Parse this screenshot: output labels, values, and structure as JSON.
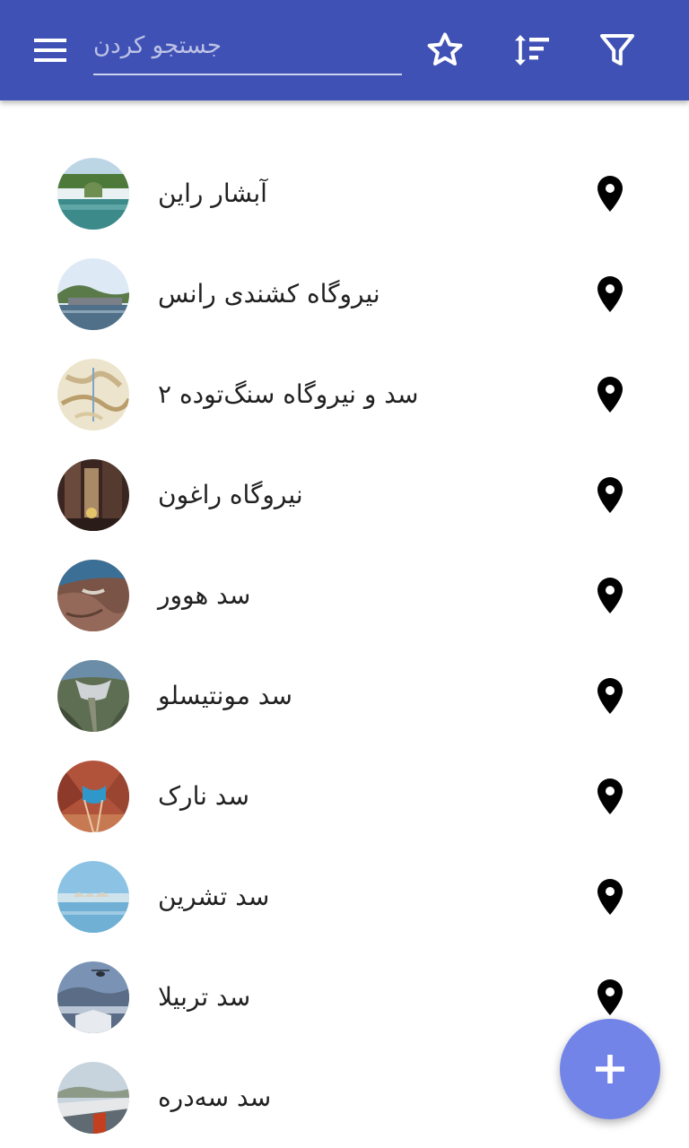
{
  "header": {
    "search_placeholder": "جستجو کردن",
    "background_color": "#3f51b5",
    "icons": [
      "menu-icon",
      "star-icon",
      "sort-icon",
      "filter-icon"
    ]
  },
  "list": {
    "items": [
      {
        "label": "آبشار راین",
        "thumb": "waterfall"
      },
      {
        "label": "نیروگاه کشندی رانس",
        "thumb": "tidal-plant"
      },
      {
        "label": "سد و نیروگاه سنگ‌توده ۲",
        "thumb": "map"
      },
      {
        "label": "نیروگاه راغون",
        "thumb": "tunnel"
      },
      {
        "label": "سد هوور",
        "thumb": "dam-aerial"
      },
      {
        "label": "سد مونتیسلو",
        "thumb": "arch-dam"
      },
      {
        "label": "سد نارک",
        "thumb": "canyon-dam"
      },
      {
        "label": "سد تشرین",
        "thumb": "misty-lake"
      },
      {
        "label": "سد تربیلا",
        "thumb": "helicopter-dam"
      },
      {
        "label": "سد سه‌دره",
        "thumb": "three-gorges"
      }
    ],
    "item_icon": "location-pin-icon"
  },
  "fab": {
    "icon": "plus-icon",
    "color": "#7384e8"
  }
}
